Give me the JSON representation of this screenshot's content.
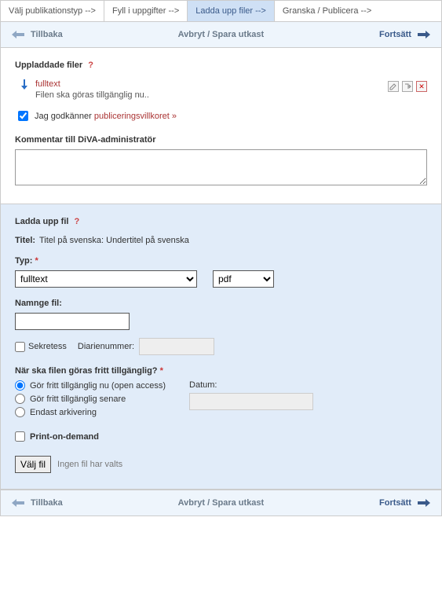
{
  "tabs": {
    "t0": "Välj publikationstyp -->",
    "t1": "Fyll i uppgifter -->",
    "t2": "Ladda upp filer -->",
    "t3": "Granska / Publicera -->"
  },
  "nav": {
    "back": "Tillbaka",
    "center": "Avbryt / Spara utkast",
    "forward": "Fortsätt"
  },
  "uploaded": {
    "heading": "Uppladdade filer",
    "help": "?",
    "file_name": "fulltext",
    "file_sub": "Filen ska göras tillgänglig nu..",
    "agree_text": "Jag godkänner ",
    "agree_link": "publiceringsvillkoret",
    "agree_raq": " »",
    "comment_label": "Kommentar till DiVA-administratör",
    "comment_value": ""
  },
  "form": {
    "heading": "Ladda upp fil",
    "help": "?",
    "title_label": "Titel:",
    "title_value": "Titel på svenska: Undertitel på svenska",
    "type_label": "Typ:",
    "type_value": "fulltext",
    "format_value": "pdf",
    "name_label": "Namnge fil:",
    "name_value": "",
    "sekretess": "Sekretess",
    "diarienummer_label": "Diarienummer:",
    "diarienummer_value": "",
    "when_label": "När ska filen göras fritt tillgänglig?",
    "r0": "Gör fritt tillgänglig nu (open access)",
    "r1": "Gör fritt tillgänglig senare",
    "r2": "Endast arkivering",
    "datum_label": "Datum:",
    "datum_value": "",
    "pod": "Print-on-demand",
    "choose_btn": "Välj fil",
    "nofile": "Ingen fil har valts"
  },
  "req": "*"
}
